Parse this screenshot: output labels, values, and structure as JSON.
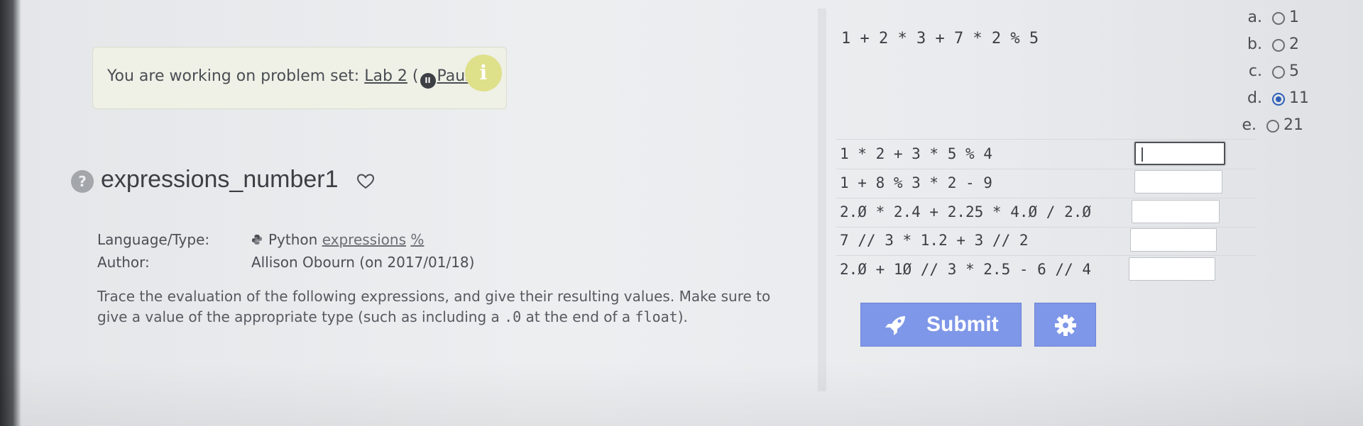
{
  "notice": {
    "prefix": "You are working on problem set:",
    "set_link": "Lab 2",
    "open_paren": "(",
    "pause_glyph": "II",
    "pause_link": "Pause",
    "close_paren": ")",
    "info_glyph": "i"
  },
  "problem": {
    "help_glyph": "?",
    "title": "expressions_number1",
    "language_label": "Language/Type:",
    "language_value": "Python",
    "language_link": "expressions",
    "language_tag": "%",
    "author_label": "Author:",
    "author_value": "Allison Obourn (on 2017/01/18)",
    "description_start": "Trace the evaluation of the following expressions, and give their resulting values. Make sure to give a value of the appropriate type (such as including a ",
    "description_code1": ".0",
    "description_mid": " at the end of a ",
    "description_code2": "float",
    "description_end": ")."
  },
  "question1": {
    "expression": "1 + 2 * 3 + 7 * 2 % 5",
    "choices": [
      {
        "letter": "a.",
        "value": "1",
        "selected": false
      },
      {
        "letter": "b.",
        "value": "2",
        "selected": false
      },
      {
        "letter": "c.",
        "value": "5",
        "selected": false
      },
      {
        "letter": "d.",
        "value": "11",
        "selected": true
      },
      {
        "letter": "e.",
        "value": "21",
        "selected": false
      }
    ]
  },
  "expressions": [
    {
      "text": "1 * 2 + 3 * 5 % 4",
      "answer": ""
    },
    {
      "text": "1 + 8 % 3 * 2 - 9",
      "answer": ""
    },
    {
      "text": "2.Ø * 2.4 + 2.25 * 4.Ø / 2.Ø",
      "answer": ""
    },
    {
      "text": "7 // 3 * 1.2 + 3 // 2",
      "answer": ""
    },
    {
      "text": "2.Ø + 1Ø // 3 * 2.5 - 6 // 4",
      "answer": ""
    }
  ],
  "buttons": {
    "submit_label": "Submit"
  },
  "colors": {
    "accent": "#7f97e8",
    "radio_selected": "#2d5fb8",
    "notice_bg": "#eff0e6",
    "info_icon": "#dfe08a"
  }
}
